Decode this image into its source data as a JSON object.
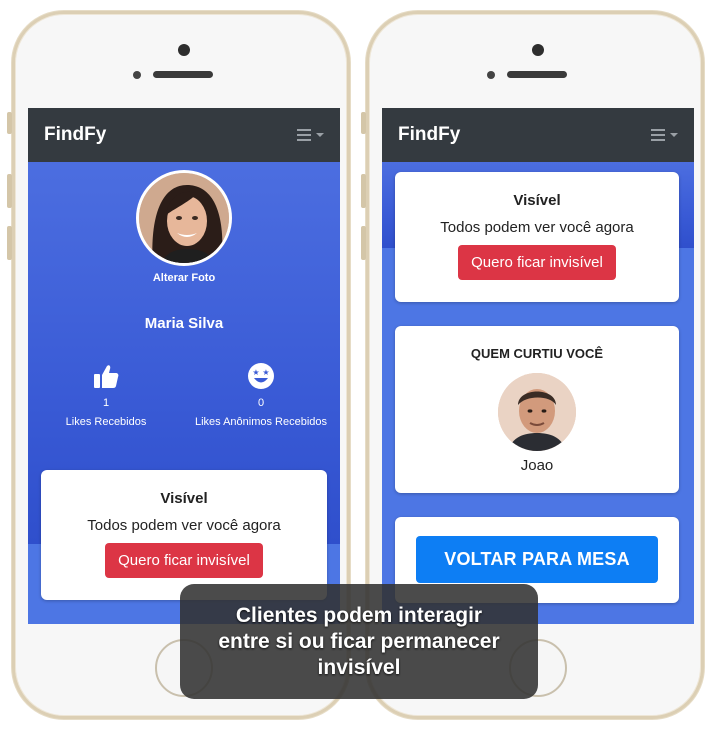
{
  "app": {
    "brand": "FindFy"
  },
  "profile": {
    "change_photo_label": "Alterar Foto",
    "name": "Maria Silva",
    "stats": [
      {
        "icon": "thumbs-up-icon",
        "count": "1",
        "label": "Likes Recebidos"
      },
      {
        "icon": "star-eyes-smiley-icon",
        "count": "0",
        "label": "Likes Anônimos Recebidos"
      }
    ]
  },
  "visibility": {
    "title": "Visível",
    "text": "Todos podem ver você agora",
    "button_label": "Quero ficar invisível"
  },
  "likes": {
    "title": "QUEM CURTIU VOCÊ",
    "person_name": "Joao"
  },
  "back_button_label": "VOLTAR PARA MESA",
  "caption": "Clientes podem interagir entre si ou ficar permanecer invisível",
  "colors": {
    "navbar": "#343a40",
    "background_gradient": "#3a5bd6",
    "danger": "#dc3545",
    "primary": "#0d7ef4"
  }
}
